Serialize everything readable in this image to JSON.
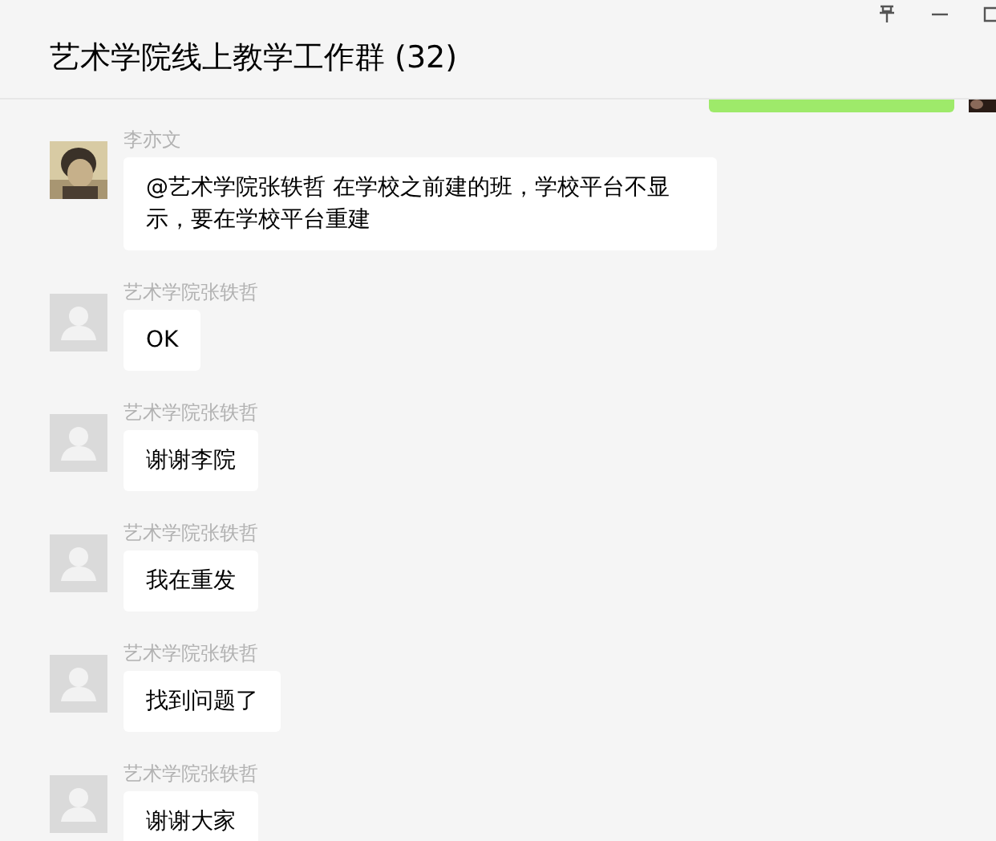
{
  "window": {
    "title": "艺术学院线上教学工作群 (32)"
  },
  "messages": [
    {
      "sender": "李亦文",
      "text": "@艺术学院张轶哲 在学校之前建的班，学校平台不显示，要在学校平台重建"
    },
    {
      "sender": "艺术学院张轶哲",
      "kind": "default",
      "text": "OK"
    },
    {
      "sender": "艺术学院张轶哲",
      "kind": "default",
      "text": "谢谢李院"
    },
    {
      "sender": "艺术学院张轶哲",
      "kind": "default",
      "text": "我在重发"
    },
    {
      "sender": "艺术学院张轶哲",
      "kind": "default",
      "text": "找到问题了"
    },
    {
      "sender": "艺术学院张轶哲",
      "kind": "default",
      "text": "谢谢大家"
    }
  ]
}
